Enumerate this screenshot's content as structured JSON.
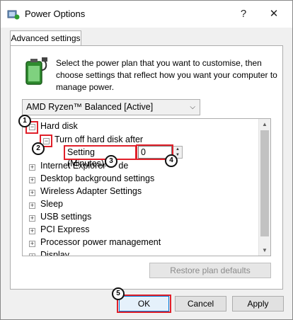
{
  "window": {
    "title": "Power Options",
    "help_label": "?",
    "close_label": "✕"
  },
  "tab": {
    "label": "Advanced settings"
  },
  "description": "Select the power plan that you want to customise, then choose settings that reflect how you want your computer to manage power.",
  "plan_select": {
    "value": "AMD Ryzen™ Balanced [Active]"
  },
  "tree": {
    "items": [
      {
        "label": "Hard disk",
        "expander": "−"
      },
      {
        "label": "Turn off hard disk after",
        "expander": "−"
      },
      {
        "label": "Internet Explorer",
        "suffix": "de",
        "expander": "+"
      },
      {
        "label": "Desktop background settings",
        "expander": "+"
      },
      {
        "label": "Wireless Adapter Settings",
        "expander": "+"
      },
      {
        "label": "Sleep",
        "expander": "+"
      },
      {
        "label": "USB settings",
        "expander": "+"
      },
      {
        "label": "PCI Express",
        "expander": "+"
      },
      {
        "label": "Processor power management",
        "expander": "+"
      },
      {
        "label": "Display",
        "expander": "+"
      }
    ],
    "setting_label": "Setting (Minutes):",
    "setting_value": "0"
  },
  "buttons": {
    "restore": "Restore plan defaults",
    "ok": "OK",
    "cancel": "Cancel",
    "apply": "Apply"
  },
  "markers": [
    "1",
    "2",
    "3",
    "4",
    "5"
  ],
  "colors": {
    "annotation_red": "#e0202a"
  }
}
